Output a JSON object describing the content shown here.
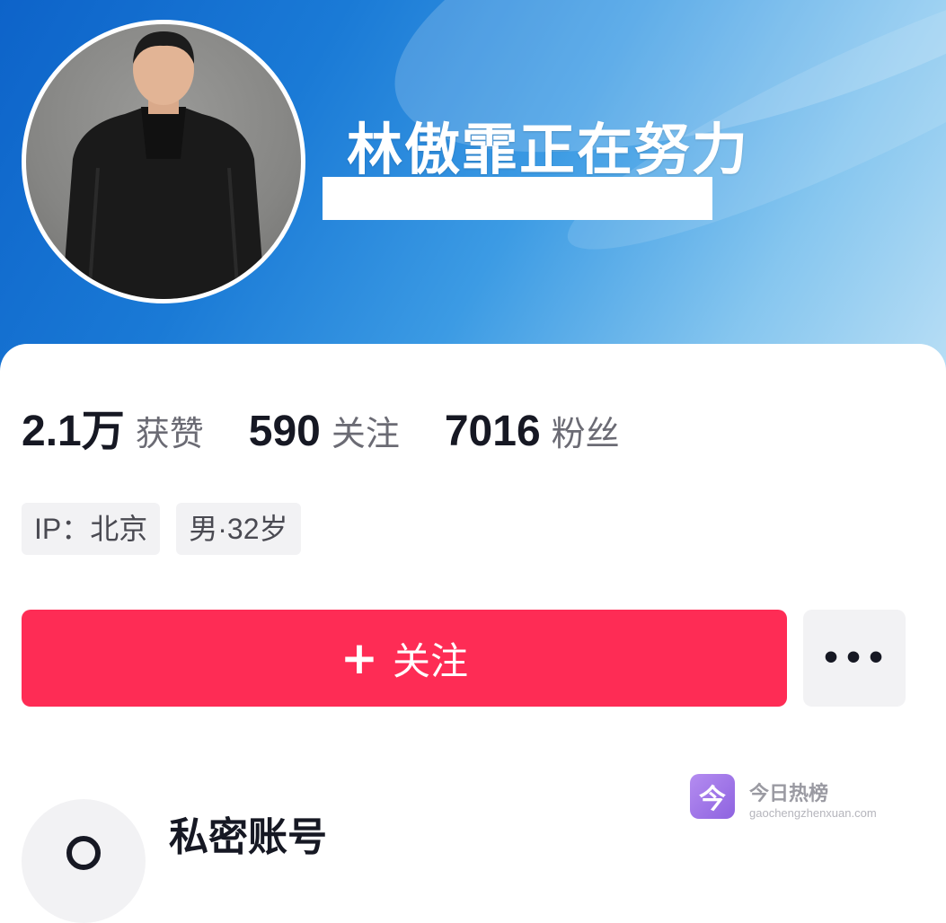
{
  "profile": {
    "nickname": "林傲霏正在努力"
  },
  "stats": [
    {
      "value": "2.1万",
      "label": "获赞"
    },
    {
      "value": "590",
      "label": "关注"
    },
    {
      "value": "7016",
      "label": "粉丝"
    }
  ],
  "tags": [
    "IP：北京",
    "男·32岁"
  ],
  "actions": {
    "follow_label": "关注",
    "follow_plus": "+",
    "more_label": "•••"
  },
  "private": {
    "title": "私密账号"
  },
  "watermark": {
    "logo_char": "今",
    "title": "今日热榜",
    "url": "gaochengzhenxuan.com"
  },
  "colors": {
    "follow_button": "#fe2c55",
    "banner_blue": "#1a7ad6",
    "text_primary": "#161823"
  }
}
